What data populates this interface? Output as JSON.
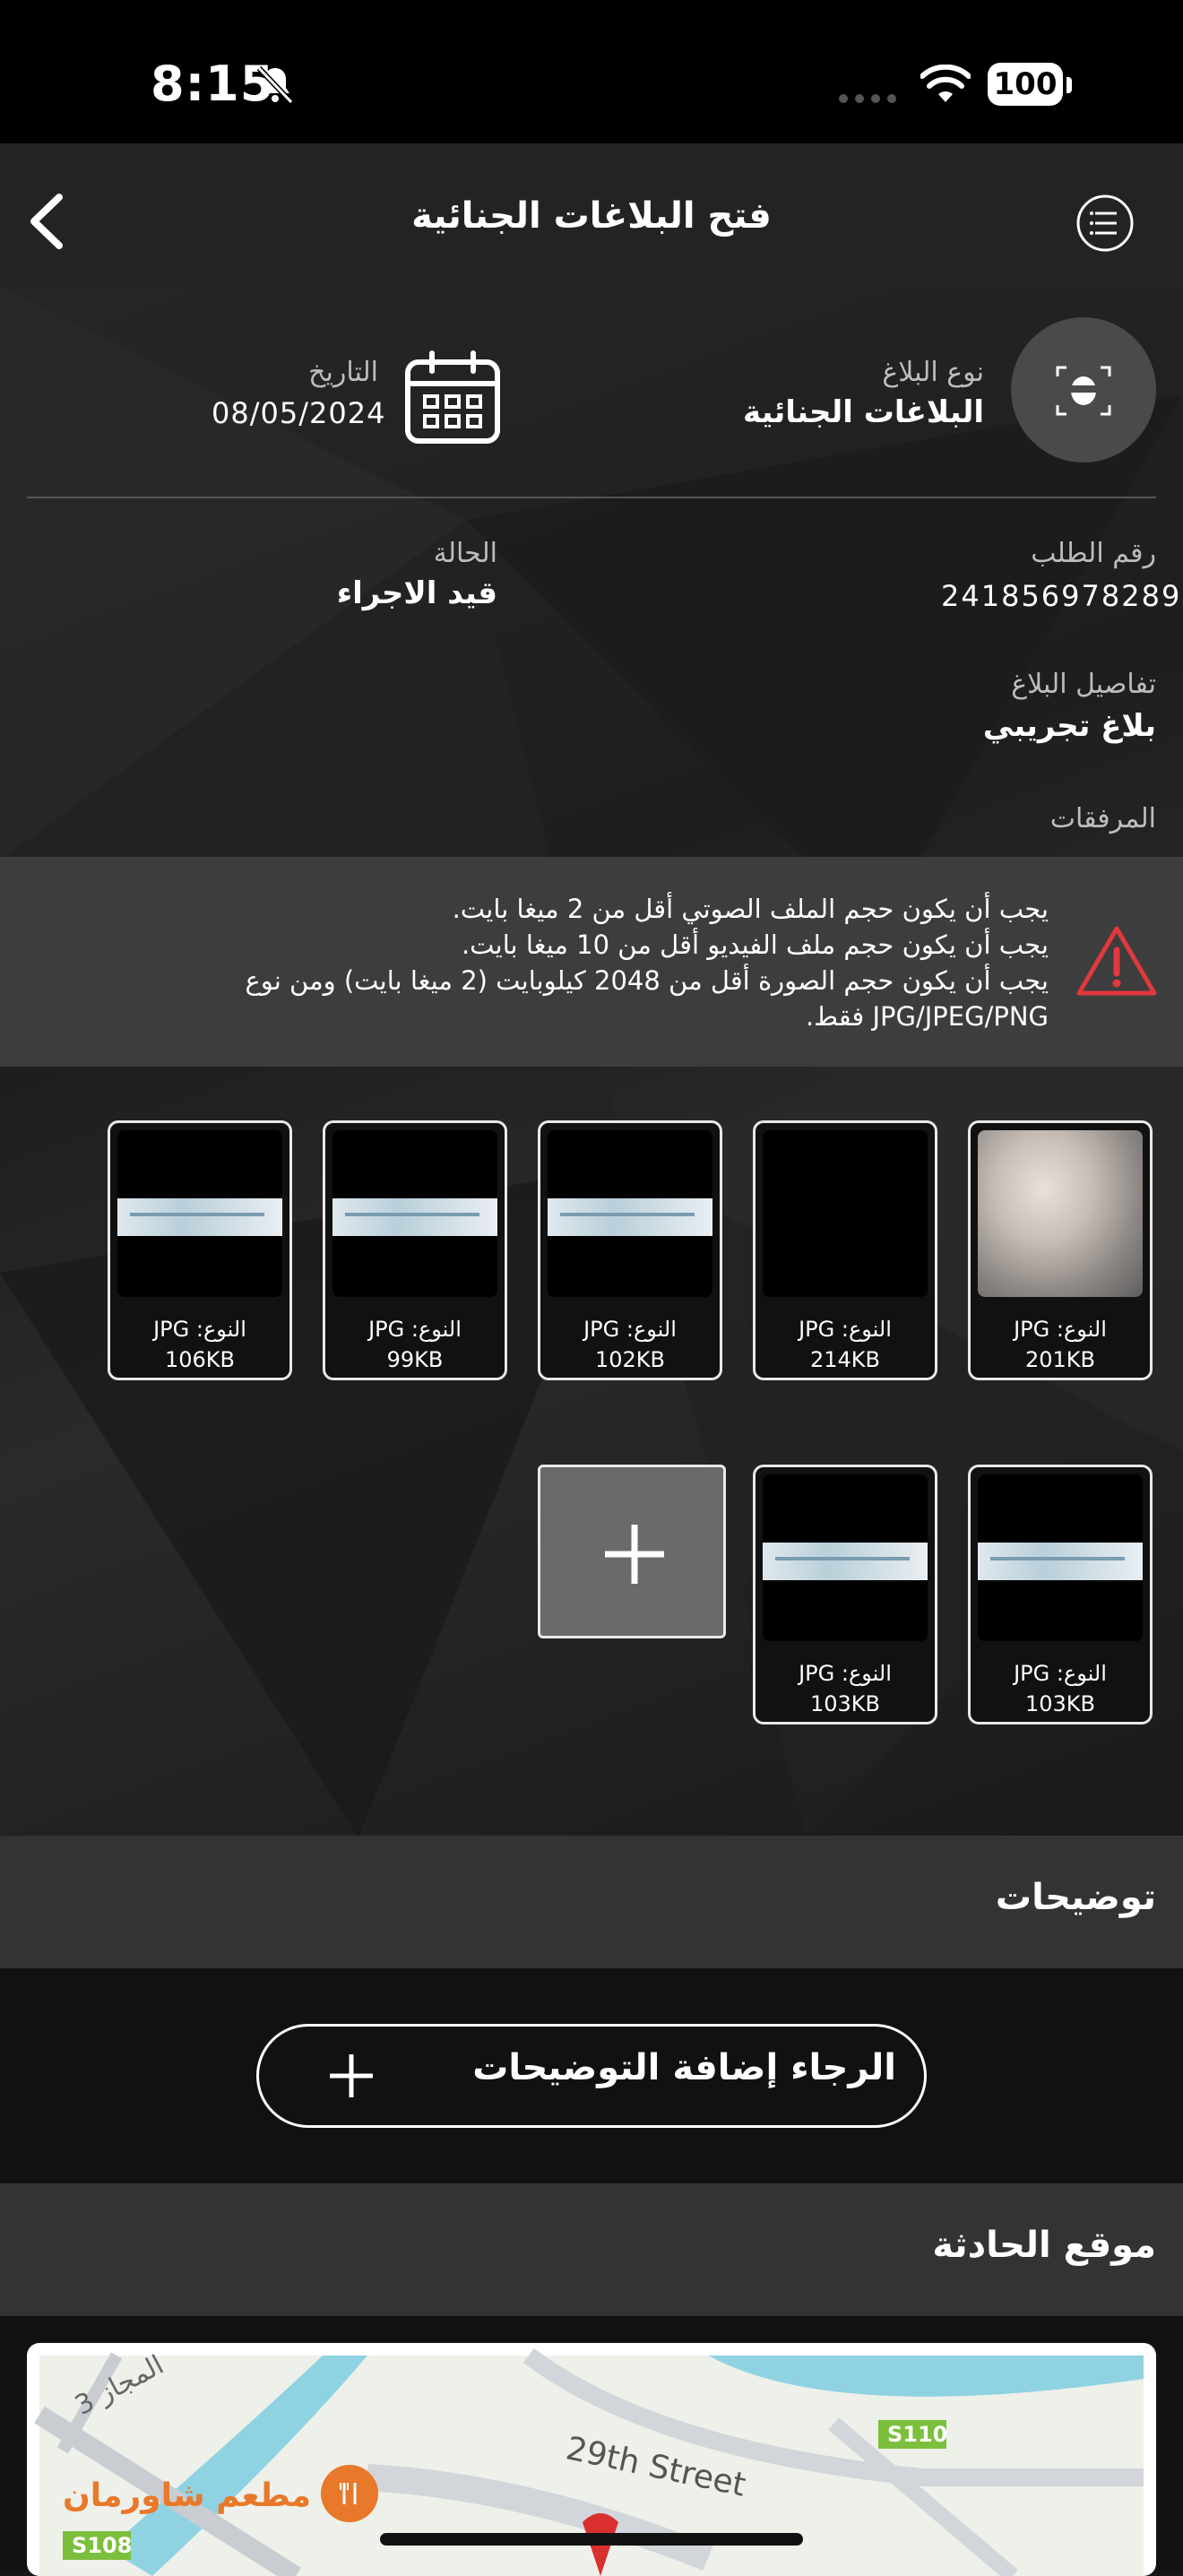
{
  "status_bar": {
    "time": "8:15",
    "battery": "100"
  },
  "header": {
    "title": "فتح البلاغات الجنائية"
  },
  "report": {
    "type_label": "نوع البلاغ",
    "type_value": "البلاغات الجنائية",
    "date_label": "التاريخ",
    "date_value": "08/05/2024",
    "request_label": "رقم الطلب",
    "request_value": "241856978289",
    "status_label": "الحالة",
    "status_value": "قيد الاجراء",
    "details_label": "تفاصيل البلاغ",
    "details_value": "بلاغ تجريبي",
    "attachments_label": "المرفقات"
  },
  "warning": {
    "line1": "يجب أن يكون حجم الملف الصوتي أقل من 2 ميغا بايت.",
    "line2": "يجب أن يكون حجم ملف الفيديو أقل من 10 ميغا بايت.",
    "line3": "يجب أن يكون حجم الصورة أقل من 2048 كيلوبايت (2 ميغا بايت) ومن نوع JPG/JPEG/PNG فقط."
  },
  "attachments": [
    {
      "type": "النوع: JPG",
      "size": "201KB"
    },
    {
      "type": "النوع: JPG",
      "size": "214KB"
    },
    {
      "type": "النوع: JPG",
      "size": "102KB"
    },
    {
      "type": "النوع: JPG",
      "size": "99KB"
    },
    {
      "type": "النوع: JPG",
      "size": "106KB"
    },
    {
      "type": "النوع: JPG",
      "size": "103KB"
    },
    {
      "type": "النوع: JPG",
      "size": "103KB"
    }
  ],
  "clarifications": {
    "title": "توضيحات",
    "button": "الرجاء إضافة التوضيحات"
  },
  "location": {
    "title": "موقع الحادثة",
    "map_labels": {
      "street": "29th Street",
      "restaurant": "مطعم شاورمان",
      "road_a": "S110",
      "road_b": "S108",
      "area": "المجاز 3"
    }
  },
  "colors": {
    "warning_red": "#e0393e",
    "accent_orange": "#e8782a"
  }
}
